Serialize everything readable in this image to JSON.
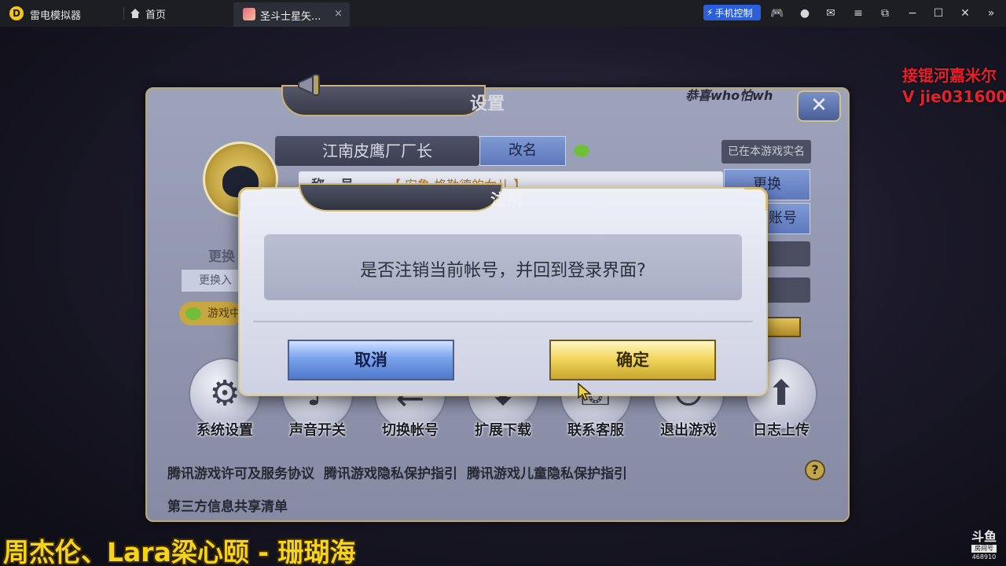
{
  "emulator": {
    "app_name": "雷电模拟器",
    "home_tab": "首页",
    "game_tab": "圣斗士星矢...",
    "tab_close": "×",
    "phone_control": "手机控制",
    "toolbar_icons": [
      "gamepad-icon",
      "user-icon",
      "mail-icon",
      "menu-icon",
      "pop-out-icon",
      "minimize-icon",
      "maximize-icon",
      "close-icon",
      "collapse-icon"
    ]
  },
  "settings": {
    "title": "设置",
    "notice": "恭喜who怕wh",
    "close_label": "✕",
    "nickname": "江南皮鹰厂厂长",
    "rename_button": "改名",
    "realname_badge": "已在本游戏实名",
    "title_label": "称号",
    "title_value": "【 安鲁·格勒德的女儿 】",
    "change_button": "更换",
    "account_button": "账号",
    "avatar_label": "更换",
    "avatar_button": "更换入",
    "game_pill": "游戏中",
    "functions": [
      {
        "label": "系统设置",
        "icon": "gear-icon",
        "glyph": "⚙"
      },
      {
        "label": "声音开关",
        "icon": "sound-icon",
        "glyph": "♪"
      },
      {
        "label": "切换帐号",
        "icon": "switch-account-icon",
        "glyph": "⇄"
      },
      {
        "label": "扩展下载",
        "icon": "download-icon",
        "glyph": "⬇"
      },
      {
        "label": "联系客服",
        "icon": "support-icon",
        "glyph": "☏"
      },
      {
        "label": "退出游戏",
        "icon": "exit-icon",
        "glyph": "⏻"
      },
      {
        "label": "日志上传",
        "icon": "upload-log-icon",
        "glyph": "⬆"
      }
    ],
    "links": [
      "腾讯游戏许可及服务协议",
      "腾讯游戏隐私保护指引",
      "腾讯游戏儿童隐私保护指引"
    ],
    "third_party": "第三方信息共享清单",
    "help": "?"
  },
  "dialog": {
    "title": "注销",
    "message": "是否注销当前帐号，并回到登录界面?",
    "cancel": "取消",
    "confirm": "确定"
  },
  "overlay": {
    "promo_line1": "接锟河嘉米尔",
    "promo_line2": "V jie031600",
    "song": "周杰伦、Lara梁心颐 - 珊瑚海",
    "watermark_logo": "斗鱼",
    "watermark_box": "房间号",
    "watermark_number": "468910"
  },
  "colors": {
    "accent_blue": "#2b5fd9",
    "promo_red": "#e8202a",
    "song_yellow": "#f6d41c",
    "confirm_gold": "#f2d860",
    "cancel_blue": "#7aa2ec"
  }
}
